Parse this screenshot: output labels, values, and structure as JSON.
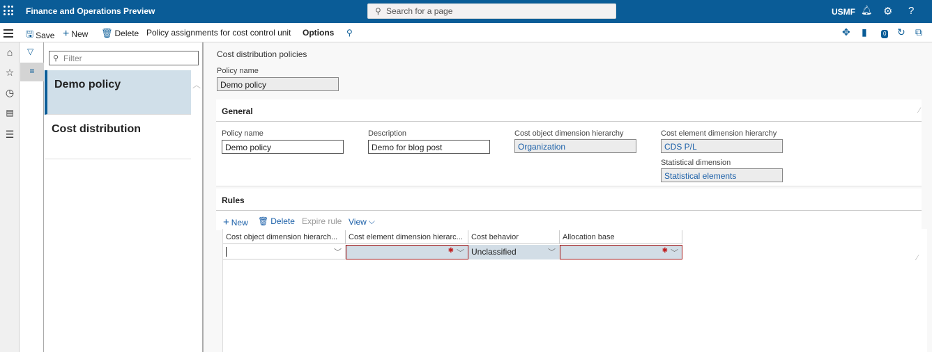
{
  "topbar": {
    "app_title": "Finance and Operations Preview",
    "search_placeholder": "Search for a page",
    "company": "USMF",
    "icons": [
      "waffle-icon",
      "bell-icon",
      "gear-icon",
      "help-icon"
    ]
  },
  "actionbar": {
    "save": "Save",
    "new": "New",
    "delete": "Delete",
    "policy_assignments": "Policy assignments for cost control unit",
    "options": "Options",
    "right_icons": [
      "diamond-icon",
      "office-icon",
      "notification-icon",
      "refresh-icon",
      "popout-icon"
    ],
    "notification_count": "0"
  },
  "navrail": [
    "home-icon",
    "star-icon",
    "clock-icon",
    "workspace-icon",
    "modules-icon"
  ],
  "listpane": {
    "filter_placeholder": "Filter",
    "items": [
      {
        "label": "Demo policy",
        "selected": true
      },
      {
        "label": "Cost distribution",
        "selected": false
      }
    ]
  },
  "main": {
    "breadcrumb": "Cost distribution policies",
    "header_policy_label": "Policy name",
    "header_policy_value": "Demo policy",
    "general": {
      "title": "General",
      "policy_name_label": "Policy name",
      "policy_name_value": "Demo policy",
      "description_label": "Description",
      "description_value": "Demo for blog post",
      "cost_object_label": "Cost object dimension hierarchy",
      "cost_object_value": "Organization",
      "cost_element_label": "Cost element dimension hierarchy",
      "cost_element_value": "CDS P/L",
      "statistical_label": "Statistical dimension",
      "statistical_value": "Statistical elements"
    },
    "rules": {
      "title": "Rules",
      "toolbar": {
        "new": "New",
        "delete": "Delete",
        "expire": "Expire rule",
        "view": "View"
      },
      "columns": [
        "Cost object dimension hierarch...",
        "Cost element dimension hierarc...",
        "Cost behavior",
        "Allocation base"
      ],
      "rows": [
        {
          "cost_object": "",
          "cost_element": "",
          "cost_behavior": "Unclassified",
          "allocation_base": ""
        }
      ]
    }
  }
}
